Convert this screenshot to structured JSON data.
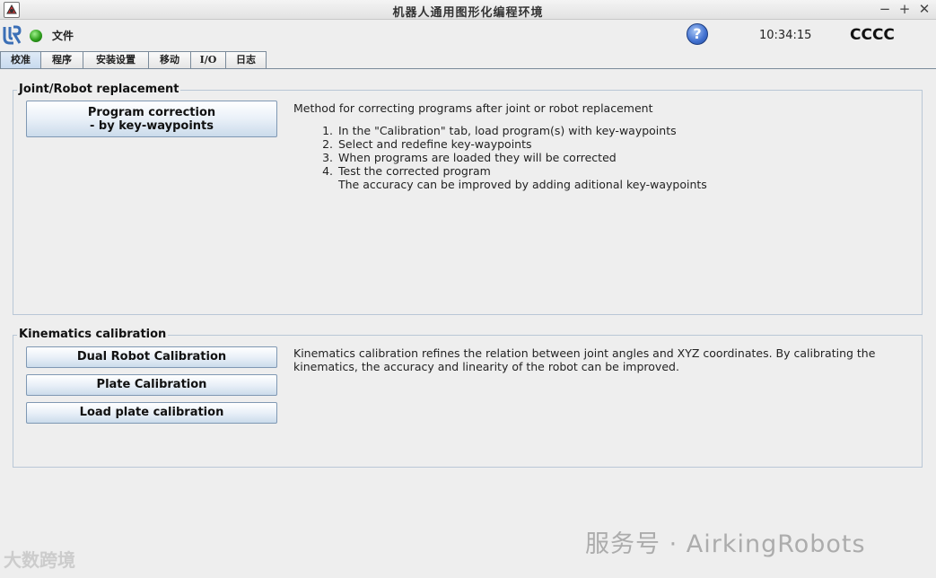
{
  "window": {
    "title": "机器人通用图形化编程环境",
    "minimize": "−",
    "maximize": "+",
    "close": "✕"
  },
  "menubar": {
    "file": "文件",
    "help": "?",
    "time": "10:34:15",
    "robot_name": "CCCC",
    "status_color": "#2e9e1c"
  },
  "tabs": [
    {
      "label": "校准",
      "active": true
    },
    {
      "label": "程序",
      "active": false
    },
    {
      "label": "安装设置",
      "active": false
    },
    {
      "label": "移动",
      "active": false
    },
    {
      "label": "I/O",
      "active": false
    },
    {
      "label": "日志",
      "active": false
    }
  ],
  "joint_panel": {
    "title": "Joint/Robot replacement",
    "button_line1": "Program correction",
    "button_line2": "- by key-waypoints",
    "description": "Method for correcting programs after joint or robot replacement",
    "steps": [
      "In the \"Calibration\" tab, load program(s) with key-waypoints",
      "Select and redefine key-waypoints",
      "When programs are loaded they will be corrected",
      "Test the corrected program"
    ],
    "step_numbers": [
      "1.",
      "2.",
      "3.",
      "4."
    ],
    "step_note": "The accuracy can be improved by adding aditional key-waypoints"
  },
  "kinematics_panel": {
    "title": "Kinematics calibration",
    "buttons": [
      "Dual Robot Calibration",
      "Plate Calibration",
      "Load plate calibration"
    ],
    "description_line1": "Kinematics calibration refines the relation between joint angles and XYZ coordinates. By calibrating the",
    "description_line2": "kinematics, the accuracy and linearity of the robot can be improved."
  },
  "watermark": {
    "text": "服务号 · AirkingRobots",
    "bottom": "大数跨境"
  }
}
